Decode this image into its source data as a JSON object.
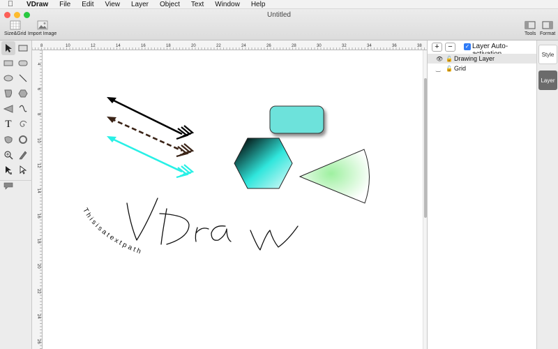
{
  "menubar": {
    "app": "VDraw",
    "items": [
      "File",
      "Edit",
      "View",
      "Layer",
      "Object",
      "Text",
      "Window",
      "Help"
    ]
  },
  "window": {
    "title": "Untitled"
  },
  "toolbar": {
    "size_grid_label": "Size&Grid",
    "import_image_label": "Import Image",
    "tools_label": "Tools",
    "format_label": "Format"
  },
  "rulers": {
    "top": [
      "8",
      "10",
      "12",
      "14",
      "16",
      "18",
      "20",
      "22",
      "24",
      "26",
      "28",
      "30",
      "32",
      "34",
      "36",
      "38"
    ],
    "left": [
      "4",
      "6",
      "8",
      "10",
      "12",
      "14",
      "16",
      "18",
      "20",
      "22",
      "24",
      "26"
    ]
  },
  "canvas": {
    "text_on_path": "T h i s   i s   a   t e x t   p a t h",
    "handwriting": "VDraw",
    "colors": {
      "arrow1": "#000000",
      "arrow2": "#3b2417",
      "arrow3": "#28f0e6",
      "rect_fill": "#6de2db",
      "hexagon_dark": "#000000",
      "hexagon_light": "#40f0e6",
      "sector_center": "#9ef0a0"
    }
  },
  "layers_panel": {
    "add": "+",
    "remove": "−",
    "auto_activation_label": "Layer Auto-activation",
    "auto_activation_checked": true,
    "rows": [
      {
        "name": "Drawing Layer",
        "selected": true
      },
      {
        "name": "Grid",
        "selected": false
      }
    ]
  },
  "sidebar": {
    "style_label": "Style",
    "layer_label": "Layer"
  }
}
